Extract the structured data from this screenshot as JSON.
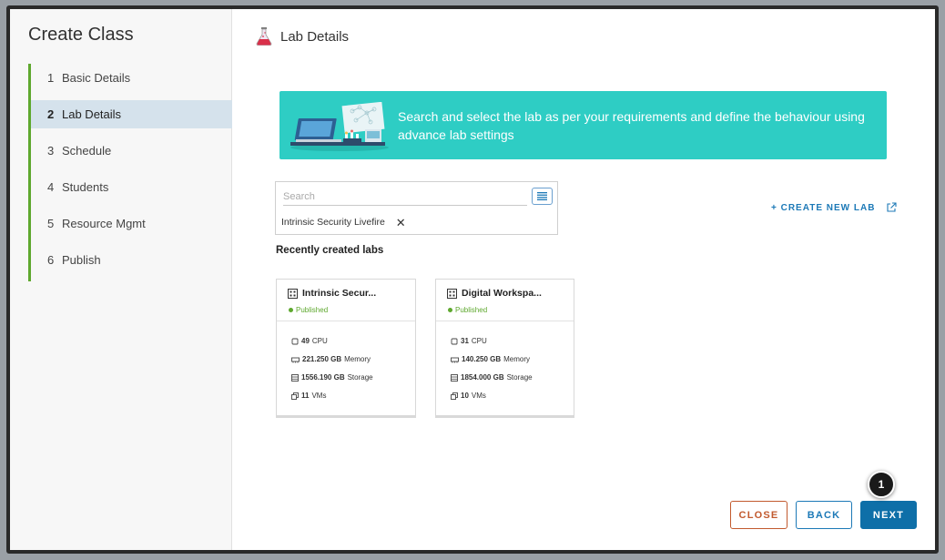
{
  "sidebar": {
    "title": "Create Class",
    "steps": [
      {
        "num": "1",
        "label": "Basic Details"
      },
      {
        "num": "2",
        "label": "Lab Details"
      },
      {
        "num": "3",
        "label": "Schedule"
      },
      {
        "num": "4",
        "label": "Students"
      },
      {
        "num": "5",
        "label": "Resource Mgmt"
      },
      {
        "num": "6",
        "label": "Publish"
      }
    ],
    "active_step": "Lab Details"
  },
  "main": {
    "header_title": "Lab Details",
    "banner_text": "Search and select the lab as per your requirements and define the behaviour using advance lab settings",
    "search": {
      "placeholder": "Search",
      "value": ""
    },
    "selected_chip": "Intrinsic Security Livefire",
    "create_lab_label": "+ CREATE NEW LAB",
    "recent_label": "Recently created labs",
    "labs": [
      {
        "name": "Intrinsic Secur...",
        "status": "Published",
        "cpu": "49",
        "cpu_unit": "CPU",
        "memory": "221.250 GB",
        "memory_unit": "Memory",
        "storage": "1556.190 GB",
        "storage_unit": "Storage",
        "vms": "11",
        "vms_unit": "VMs"
      },
      {
        "name": "Digital Workspa...",
        "status": "Published",
        "cpu": "31",
        "cpu_unit": "CPU",
        "memory": "140.250 GB",
        "memory_unit": "Memory",
        "storage": "1854.000 GB",
        "storage_unit": "Storage",
        "vms": "10",
        "vms_unit": "VMs"
      }
    ]
  },
  "footer": {
    "close_label": "CLOSE",
    "back_label": "BACK",
    "next_label": "NEXT"
  },
  "callout": {
    "number": "1"
  },
  "colors": {
    "accent_green": "#5ea82e",
    "banner_teal": "#2ecdc4",
    "primary_blue": "#0e6fa8",
    "close_orange": "#c25a2e"
  }
}
